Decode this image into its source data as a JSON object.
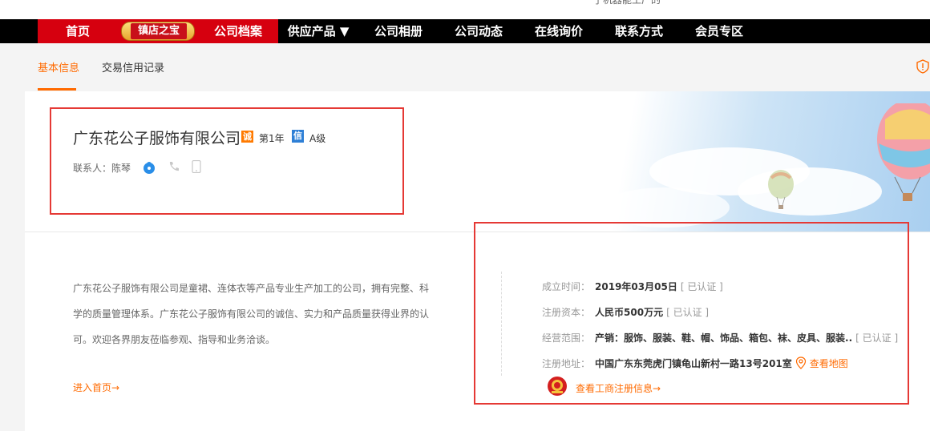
{
  "top_strip": {
    "cut_text": "了机器能工厂的"
  },
  "nav": {
    "items": [
      "首页",
      "镇店之宝",
      "公司档案",
      "供应产品 ▼",
      "公司相册",
      "公司动态",
      "在线询价",
      "联系方式",
      "会员专区"
    ]
  },
  "tabs": {
    "active": "基本信息",
    "second": "交易信用记录"
  },
  "company": {
    "name": "广东花公子服饰有限公司",
    "cheng_badge": "诚",
    "year": "第1年",
    "xin_badge": "信",
    "grade": "A级",
    "contact": "联系人：陈琴"
  },
  "intro": {
    "text": "广东花公子服饰有限公司是童裙、连体衣等产品专业生产加工的公司，拥有完整、科学的质量管理体系。广东花公子服饰有限公司的诚信、实力和产品质量获得业界的认可。欢迎各界朋友莅临参观、指导和业务洽谈。",
    "home_link": "进入首页→"
  },
  "info": {
    "founded_label": "成立时间：",
    "founded_value": "2019年03月05日",
    "founded_cert": "[ 已认证 ]",
    "capital_label": "注册资本：",
    "capital_value": "人民币500万元",
    "capital_cert": "[ 已认证 ]",
    "scope_label": "经营范围：",
    "scope_value": "产销：服饰、服装、鞋、帽、饰品、箱包、袜、皮具、服装..",
    "scope_cert": "[ 已认证 ]",
    "address_label": "注册地址：",
    "address_value": "中国广东东莞虎门镇龟山新村一路13号201室",
    "map_link": "查看地图",
    "reg_link": "查看工商注册信息→"
  },
  "colors": {
    "accent": "#ff6a00",
    "nav_red": "#d6000f",
    "annotation": "#e53935"
  }
}
